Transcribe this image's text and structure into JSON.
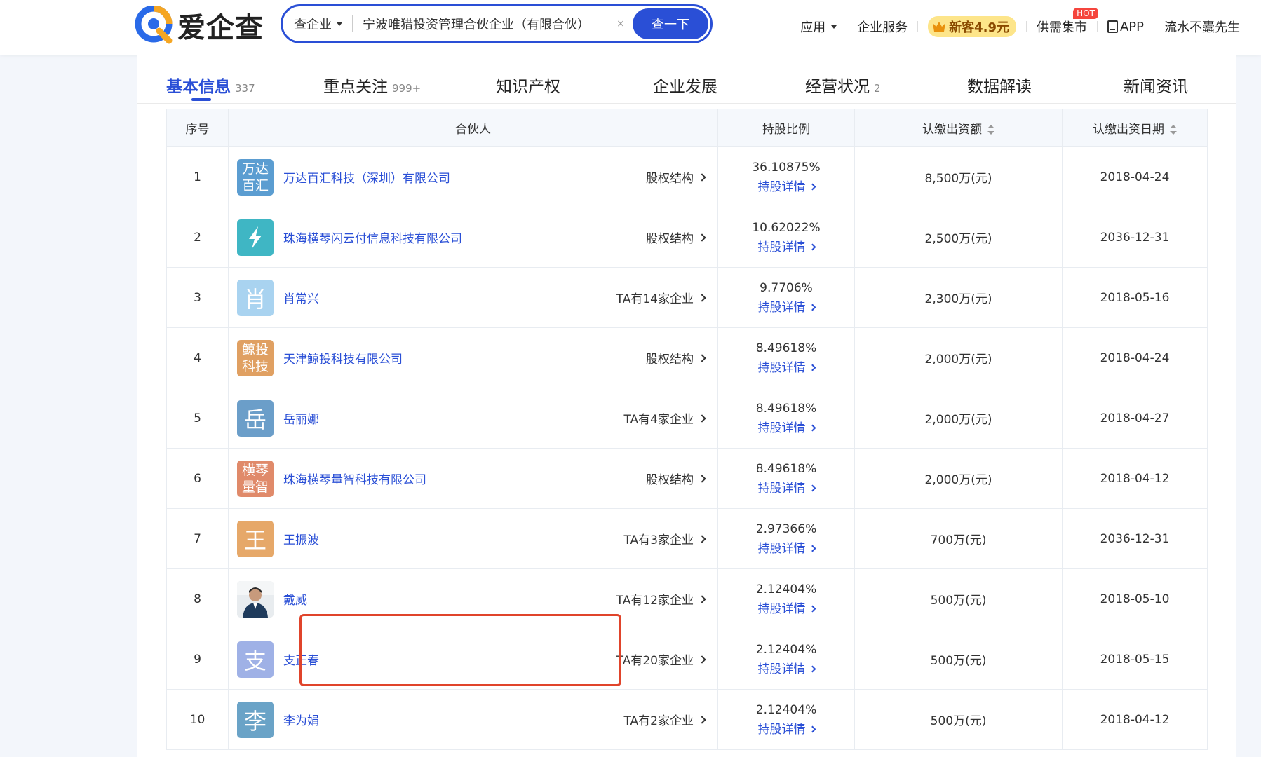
{
  "logo": {
    "text": "爱企查"
  },
  "search": {
    "type_label": "查企业",
    "value": "宁波唯猎投资管理合伙企业（有限合伙）",
    "clear": "×",
    "button": "查一下"
  },
  "nav": {
    "apps": "应用",
    "enterprise_service": "企业服务",
    "promo": "新客4.9元",
    "supply_demand": "供需集市",
    "hot": "HOT",
    "app": "APP",
    "user": "流水不蠹先生"
  },
  "tabs": [
    {
      "label": "基本信息",
      "count": "337"
    },
    {
      "label": "重点关注",
      "count": "999+"
    },
    {
      "label": "知识产权",
      "count": ""
    },
    {
      "label": "企业发展",
      "count": ""
    },
    {
      "label": "经营状况",
      "count": "2"
    },
    {
      "label": "数据解读",
      "count": ""
    },
    {
      "label": "新闻资讯",
      "count": ""
    }
  ],
  "table": {
    "headers": {
      "index": "序号",
      "partner": "合伙人",
      "ratio": "持股比例",
      "amount": "认缴出资额",
      "date": "认缴出资日期"
    },
    "detail_label": "持股详情",
    "rows": [
      {
        "index": "1",
        "avatar": "万达百汇",
        "avatar_color": "#5b9dd1",
        "name": "万达百汇科技（深圳）有限公司",
        "link": "股权结构",
        "ratio": "36.10875%",
        "amount": "8,500万(元)",
        "date": "2018-04-24"
      },
      {
        "index": "2",
        "avatar": "",
        "avatar_color": "#3fb6c4",
        "name": "珠海横琴闪云付信息科技有限公司",
        "link": "股权结构",
        "ratio": "10.62022%",
        "amount": "2,500万(元)",
        "date": "2036-12-31"
      },
      {
        "index": "3",
        "avatar": "肖",
        "avatar_color": "#a9d3f0",
        "name": "肖常兴",
        "link": "TA有14家企业",
        "ratio": "9.7706%",
        "amount": "2,300万(元)",
        "date": "2018-05-16"
      },
      {
        "index": "4",
        "avatar": "鲸投科技",
        "avatar_color": "#e0a062",
        "name": "天津鲸投科技有限公司",
        "link": "股权结构",
        "ratio": "8.49618%",
        "amount": "2,000万(元)",
        "date": "2018-04-24"
      },
      {
        "index": "5",
        "avatar": "岳",
        "avatar_color": "#6b9ec9",
        "name": "岳丽娜",
        "link": "TA有4家企业",
        "ratio": "8.49618%",
        "amount": "2,000万(元)",
        "date": "2018-04-27"
      },
      {
        "index": "6",
        "avatar": "横琴量智",
        "avatar_color": "#e08a6a",
        "name": "珠海横琴量智科技有限公司",
        "link": "股权结构",
        "ratio": "8.49618%",
        "amount": "2,000万(元)",
        "date": "2018-04-12"
      },
      {
        "index": "7",
        "avatar": "王",
        "avatar_color": "#e6a869",
        "name": "王振波",
        "link": "TA有3家企业",
        "ratio": "2.97366%",
        "amount": "700万(元)",
        "date": "2036-12-31"
      },
      {
        "index": "8",
        "avatar": "",
        "avatar_color": "#dfe4e8",
        "name": "戴威",
        "link": "TA有12家企业",
        "ratio": "2.12404%",
        "amount": "500万(元)",
        "date": "2018-05-10"
      },
      {
        "index": "9",
        "avatar": "支",
        "avatar_color": "#9fb1e6",
        "name": "支正春",
        "link": "TA有20家企业",
        "ratio": "2.12404%",
        "amount": "500万(元)",
        "date": "2018-05-15"
      },
      {
        "index": "10",
        "avatar": "李",
        "avatar_color": "#6aa3c7",
        "name": "李为娟",
        "link": "TA有2家企业",
        "ratio": "2.12404%",
        "amount": "500万(元)",
        "date": "2018-04-12"
      }
    ]
  },
  "colors": {
    "brand": "#2a4fd6",
    "highlight": "#e0442b",
    "promo_bg": "#fde58a"
  }
}
